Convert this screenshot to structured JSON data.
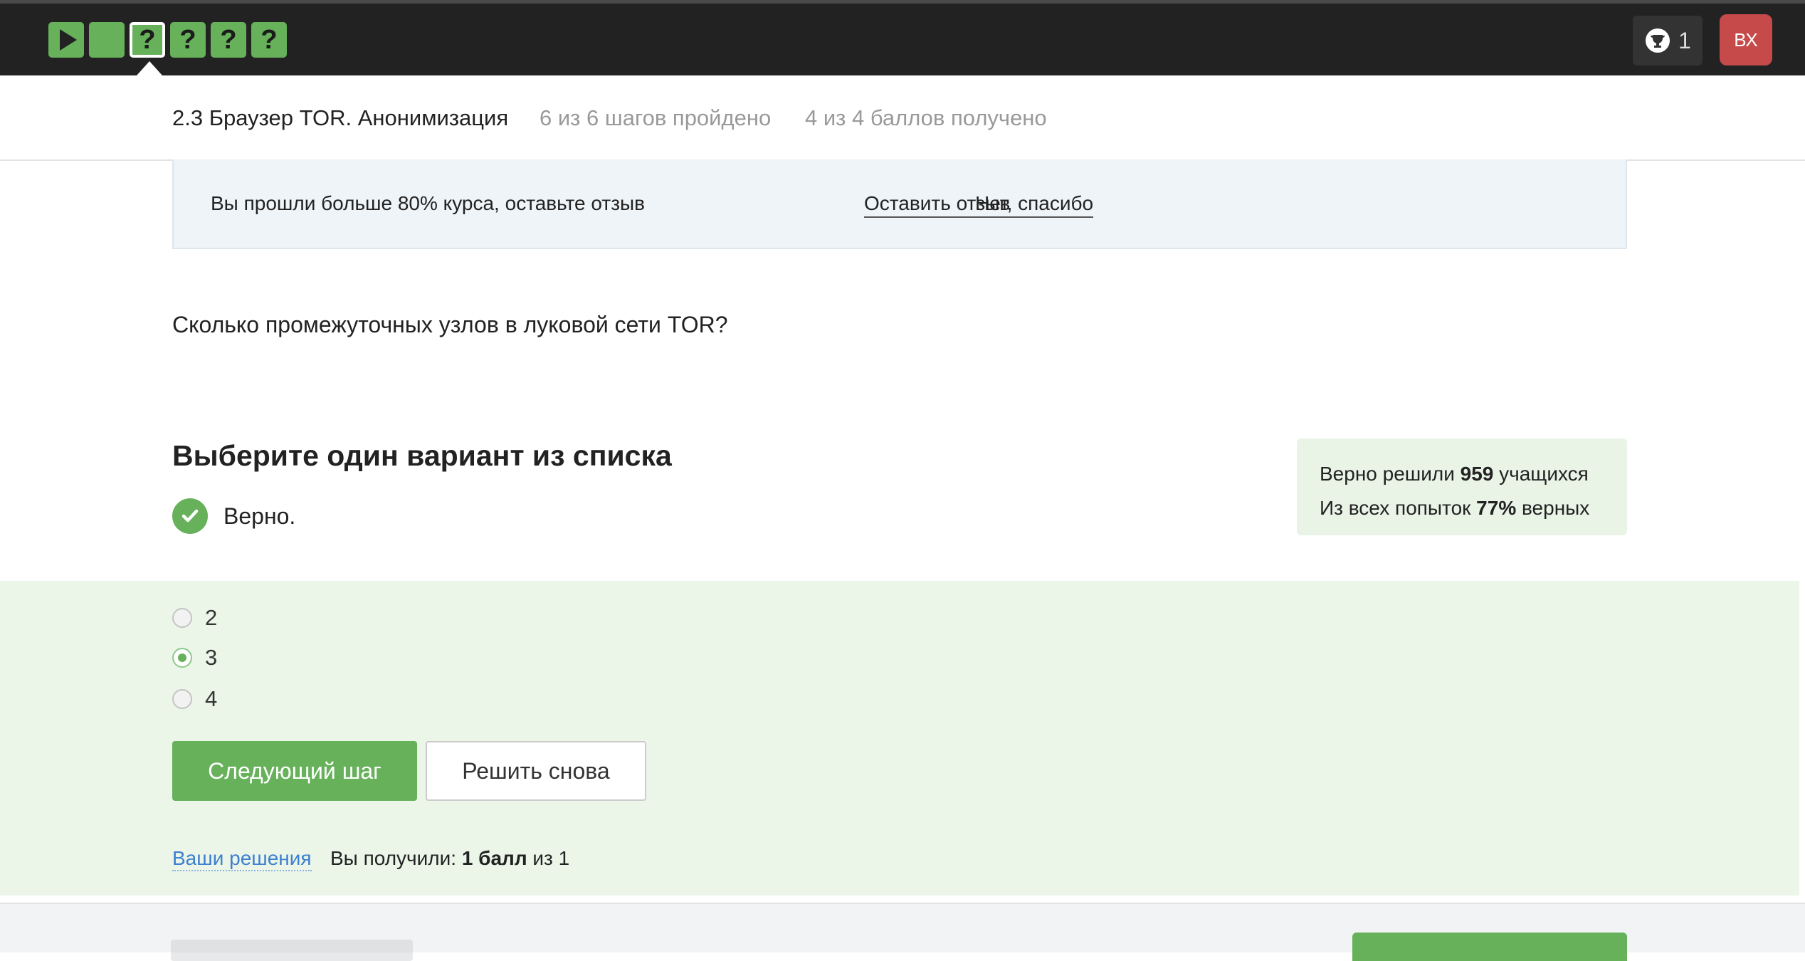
{
  "topbar": {
    "steps": [
      {
        "type": "video",
        "state": "passed",
        "label": ""
      },
      {
        "type": "text",
        "state": "passed",
        "label": ""
      },
      {
        "type": "quiz",
        "state": "current",
        "label": "?"
      },
      {
        "type": "quiz",
        "state": "passed",
        "label": "?"
      },
      {
        "type": "quiz",
        "state": "passed",
        "label": "?"
      },
      {
        "type": "quiz",
        "state": "passed",
        "label": "?"
      }
    ],
    "awards_icon": "trophy-icon",
    "awards_count": "1",
    "avatar_initials": "ВХ"
  },
  "lesson": {
    "title": "2.3 Браузер TOR. Анонимизация",
    "steps_progress": "6 из 6 шагов пройдено",
    "score_progress": "4 из 4 баллов  получено"
  },
  "banner": {
    "text": "Вы прошли больше 80% курса, оставьте отзыв",
    "leave_review": "Оставить отзыв",
    "no_thanks": "Нет, спасибо"
  },
  "question": {
    "text": "Сколько промежуточных узлов в луковой сети TOR?",
    "instruction": "Выберите один вариант из списка",
    "verdict": "Верно."
  },
  "stats": {
    "line1_prefix": "Верно решили ",
    "solved_count": "959",
    "line1_suffix": " учащихся",
    "line2_prefix": "Из всех попыток ",
    "success_rate": "77%",
    "line2_suffix": " верных"
  },
  "options": [
    {
      "label": "2",
      "selected": false
    },
    {
      "label": "3",
      "selected": true
    },
    {
      "label": "4",
      "selected": false
    }
  ],
  "actions": {
    "next_step": "Следующий шаг",
    "solve_again": "Решить снова",
    "your_solutions": "Ваши решения",
    "score_prefix": "Вы получили: ",
    "score_value": "1 балл",
    "score_suffix": " из 1"
  },
  "colors": {
    "accent_green": "#66b15a",
    "answer_bg": "#ebf6e9",
    "link_blue": "#3d7fd0",
    "avatar_red": "#c64a4a",
    "topbar_bg": "#222222"
  }
}
